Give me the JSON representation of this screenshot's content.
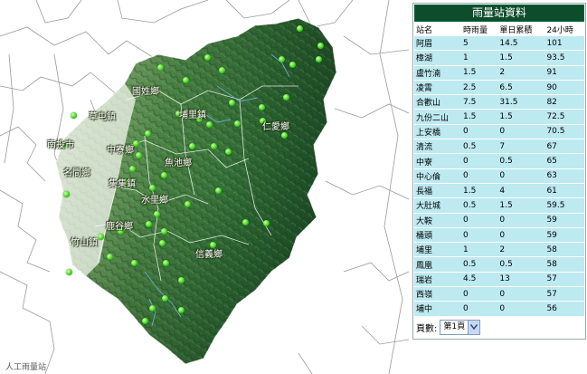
{
  "map": {
    "towns": [
      {
        "name": "國姓鄉"
      },
      {
        "name": "草屯鎮"
      },
      {
        "name": "埔里鎮"
      },
      {
        "name": "南投市"
      },
      {
        "name": "中寮鄉"
      },
      {
        "name": "仁愛鄉"
      },
      {
        "name": "名間鄉"
      },
      {
        "name": "魚池鄉"
      },
      {
        "name": "集集鎮"
      },
      {
        "name": "水里鄉"
      },
      {
        "name": "鹿谷鄉"
      },
      {
        "name": "竹山鎮"
      },
      {
        "name": "信義鄉"
      }
    ],
    "footer": "人工雨量站"
  },
  "panel": {
    "title": "雨量站資料",
    "headers": [
      "站名",
      "時雨量",
      "單日累積",
      "24小時"
    ],
    "rows": [
      [
        "阿眉",
        "5",
        "14.5",
        "101"
      ],
      [
        "樟湖",
        "1",
        "1.5",
        "93.5"
      ],
      [
        "盧竹湳",
        "1.5",
        "2",
        "91"
      ],
      [
        "凌霄",
        "2.5",
        "6.5",
        "90"
      ],
      [
        "合歡山",
        "7.5",
        "31.5",
        "82"
      ],
      [
        "九份二山",
        "1.5",
        "1.5",
        "72.5"
      ],
      [
        "上安橋",
        "0",
        "0",
        "70.5"
      ],
      [
        "清流",
        "0.5",
        "7",
        "67"
      ],
      [
        "中寮",
        "0",
        "0.5",
        "65"
      ],
      [
        "中心倫",
        "0",
        "0",
        "63"
      ],
      [
        "長福",
        "1.5",
        "4",
        "61"
      ],
      [
        "大肚城",
        "0.5",
        "1.5",
        "59.5"
      ],
      [
        "大鞍",
        "0",
        "0",
        "59"
      ],
      [
        "桶頭",
        "0",
        "0",
        "59"
      ],
      [
        "埔里",
        "1",
        "2",
        "58"
      ],
      [
        "鳳凰",
        "0.5",
        "0.5",
        "58"
      ],
      [
        "瑞岩",
        "4.5",
        "13",
        "57"
      ],
      [
        "西嶺",
        "0",
        "0",
        "57"
      ],
      [
        "埔中",
        "0",
        "0",
        "56"
      ]
    ],
    "pager_label": "頁數:",
    "page_value": "第1頁"
  },
  "colors": {
    "panel_header": "#0e4d2c",
    "row_bg": "#bde9f1",
    "station": "#3fd81a"
  }
}
